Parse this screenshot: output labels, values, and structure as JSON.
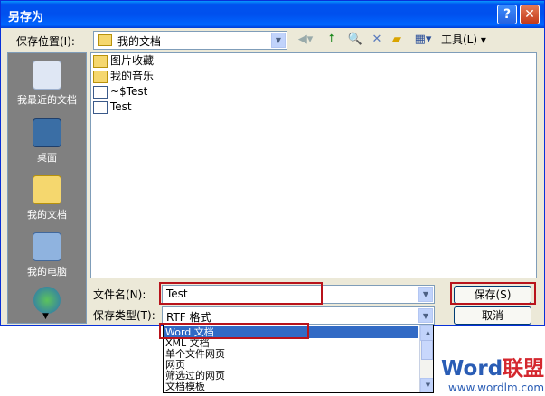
{
  "window": {
    "title": "另存为",
    "help_label": "?",
    "close_label": "✕"
  },
  "toolbar": {
    "save_in_label": "保存位置(I):",
    "location": "我的文档",
    "tools_label": "工具(L)",
    "icons": [
      "back-icon",
      "up-folder-icon",
      "search-web-icon",
      "delete-icon",
      "new-folder-icon",
      "views-icon"
    ]
  },
  "places": [
    {
      "label": "我最近的文档",
      "icon": "recent-documents-icon"
    },
    {
      "label": "桌面",
      "icon": "desktop-icon"
    },
    {
      "label": "我的文档",
      "icon": "my-documents-icon"
    },
    {
      "label": "我的电脑",
      "icon": "my-computer-icon"
    }
  ],
  "files": [
    {
      "name": "图片收藏",
      "type": "folder"
    },
    {
      "name": "我的音乐",
      "type": "folder"
    },
    {
      "name": "~$Test",
      "type": "word-doc"
    },
    {
      "name": "Test",
      "type": "word-doc"
    }
  ],
  "form": {
    "filename_label": "文件名(N):",
    "filename_value": "Test",
    "filetype_label": "保存类型(T):",
    "filetype_value": "RTF 格式",
    "save_label": "保存(S)",
    "cancel_label": "取消"
  },
  "dropdown": {
    "options": [
      "Word 文档",
      "XML 文档",
      "单个文件网页",
      "网页",
      "筛选过的网页",
      "文档模板"
    ],
    "selected_index": 0
  },
  "watermark": {
    "word": "Word",
    "cn": "联盟",
    "url": "www.wordlm.com"
  },
  "colors": {
    "title_bar": "#0053ee",
    "highlight_box": "#b8131b",
    "selection": "#316ac5",
    "dialog_bg": "#ece9d8"
  }
}
